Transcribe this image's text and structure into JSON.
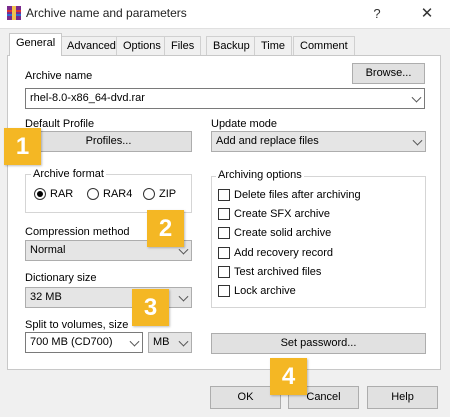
{
  "window": {
    "title": "Archive name and parameters",
    "help_glyph": "?",
    "close_glyph": "✕"
  },
  "tabs": [
    {
      "label": "General",
      "active": true
    },
    {
      "label": "Advanced"
    },
    {
      "label": "Options"
    },
    {
      "label": "Files"
    },
    {
      "label": "Backup"
    },
    {
      "label": "Time"
    },
    {
      "label": "Comment"
    }
  ],
  "archive_name": {
    "label": "Archive name",
    "browse_label": "Browse...",
    "value": "rhel-8.0-x86_64-dvd.rar"
  },
  "default_profile": {
    "label": "Default Profile",
    "profiles_button": "Profiles..."
  },
  "update_mode": {
    "label": "Update mode",
    "value": "Add and replace files"
  },
  "archive_format": {
    "label": "Archive format",
    "options": [
      {
        "label": "RAR",
        "selected": true
      },
      {
        "label": "RAR4",
        "selected": false
      },
      {
        "label": "ZIP",
        "selected": false
      }
    ]
  },
  "compression_method": {
    "label": "Compression method",
    "value": "Normal"
  },
  "dictionary_size": {
    "label": "Dictionary size",
    "value": "32 MB"
  },
  "split_volumes": {
    "label": "Split to volumes, size",
    "value": "700 MB  (CD700)",
    "unit": "MB"
  },
  "archiving_options": {
    "label": "Archiving options",
    "items": [
      {
        "label": "Delete files after archiving",
        "checked": false
      },
      {
        "label": "Create SFX archive",
        "checked": false
      },
      {
        "label": "Create solid archive",
        "checked": false
      },
      {
        "label": "Add recovery record",
        "checked": false
      },
      {
        "label": "Test archived files",
        "checked": false
      },
      {
        "label": "Lock archive",
        "checked": false
      }
    ]
  },
  "set_password_label": "Set password...",
  "footer": {
    "ok": "OK",
    "cancel": "Cancel",
    "help": "Help"
  },
  "badges": [
    "1",
    "2",
    "3",
    "4"
  ],
  "colors": {
    "badge": "#f4b724",
    "dialog_bg": "#f0f0f0",
    "panel_bg": "#ffffff"
  }
}
